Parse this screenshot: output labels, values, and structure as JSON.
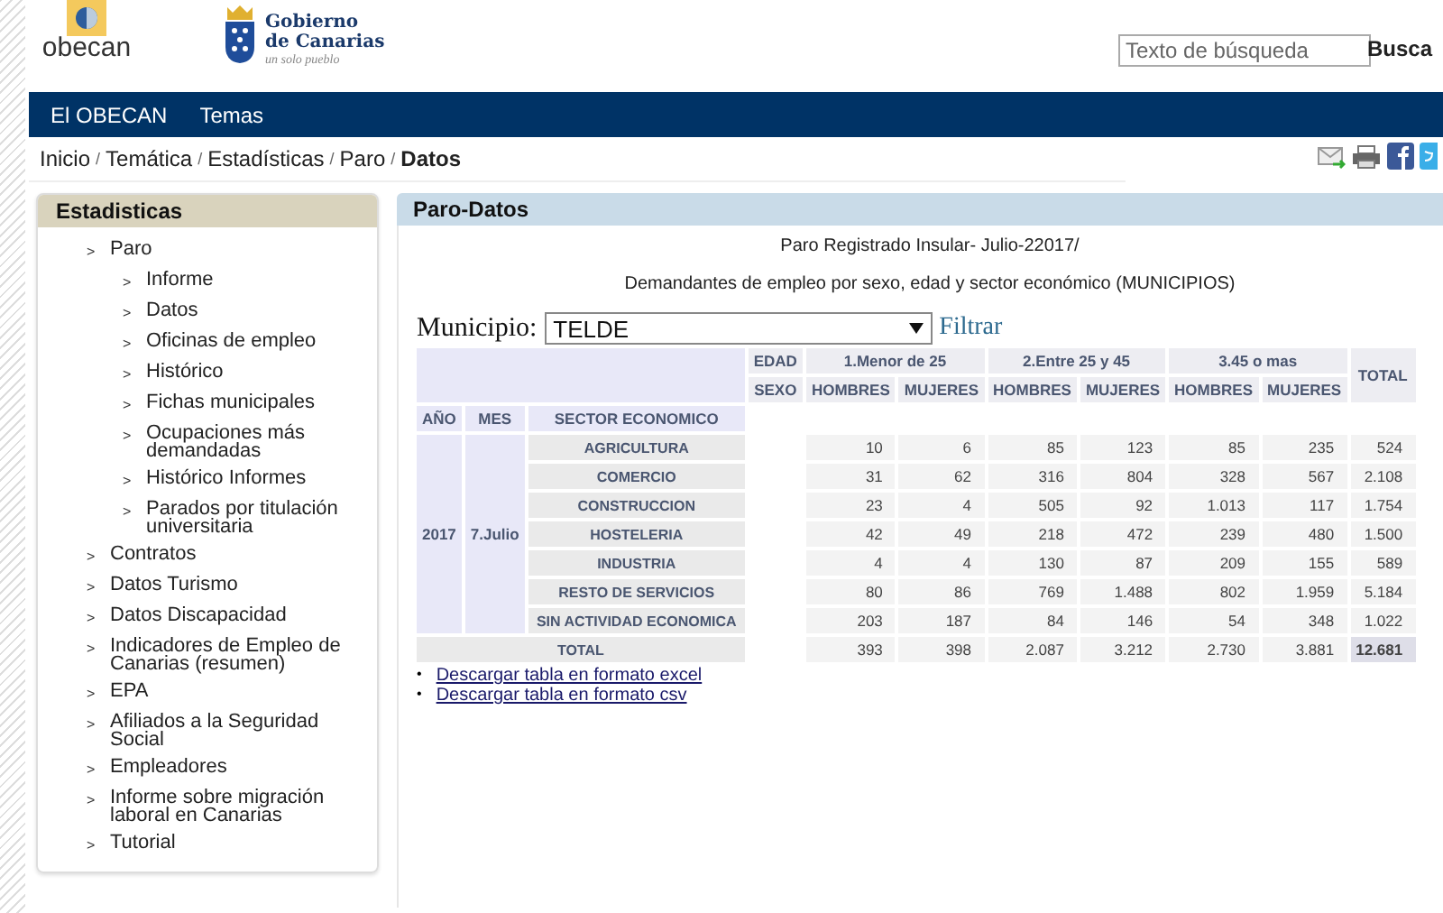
{
  "header": {
    "logo_text": "obecan",
    "gov_name_lines": [
      "Gobierno",
      "de Canarias"
    ],
    "gov_tagline": "un solo pueblo",
    "search": {
      "placeholder": "Texto de búsqueda"
    },
    "search_button": "Busca"
  },
  "nav": [
    "El OBECAN",
    "Temas"
  ],
  "breadcrumb": {
    "separator": "/",
    "items": [
      "Inicio",
      "Temática",
      "Estadísticas",
      "Paro",
      "Datos"
    ]
  },
  "sidebar": {
    "title": "Estadisticas",
    "bullet": ">",
    "items": [
      {
        "label": "Paro",
        "children": [
          {
            "label": "Informe"
          },
          {
            "label": "Datos"
          },
          {
            "label": "Oficinas de empleo"
          },
          {
            "label": "Histórico"
          },
          {
            "label": "Fichas municipales"
          },
          {
            "label": "Ocupaciones más demandadas"
          },
          {
            "label": "Histórico Informes"
          },
          {
            "label": "Parados por titulación universitaria"
          }
        ]
      },
      {
        "label": "Contratos"
      },
      {
        "label": "Datos Turismo"
      },
      {
        "label": "Datos Discapacidad"
      },
      {
        "label": "Indicadores de Empleo de Canarias (resumen)"
      },
      {
        "label": "EPA"
      },
      {
        "label": "Afiliados a la Seguridad Social"
      },
      {
        "label": "Empleadores"
      },
      {
        "label": "Informe sobre migración laboral en Canarias"
      },
      {
        "label": "Tutorial"
      }
    ]
  },
  "panel": {
    "title": "Paro-Datos",
    "report_title": "Paro Registrado Insular- Julio-22017/",
    "subtitle": "Demandantes de empleo por sexo, edad y sector económico (MUNICIPIOS)",
    "filter": {
      "label": "Municipio:",
      "value": "TELDE",
      "button": "Filtrar"
    },
    "table": {
      "edad_label": "EDAD",
      "sexo_label": "SEXO",
      "age_groups": [
        "1.Menor de 25",
        "2.Entre 25 y 45",
        "3.45 o mas"
      ],
      "sexes": [
        "HOMBRES",
        "MUJERES",
        "HOMBRES",
        "MUJERES",
        "HOMBRES",
        "MUJERES"
      ],
      "total_label": "TOTAL",
      "row_headers": [
        "AÑO",
        "MES",
        "SECTOR ECONOMICO"
      ],
      "year": "2017",
      "month": "7.Julio",
      "rows": [
        {
          "sector": "AGRICULTURA",
          "values": [
            "10",
            "6",
            "85",
            "123",
            "85",
            "235",
            "524"
          ]
        },
        {
          "sector": "COMERCIO",
          "values": [
            "31",
            "62",
            "316",
            "804",
            "328",
            "567",
            "2.108"
          ]
        },
        {
          "sector": "CONSTRUCCION",
          "values": [
            "23",
            "4",
            "505",
            "92",
            "1.013",
            "117",
            "1.754"
          ]
        },
        {
          "sector": "HOSTELERIA",
          "values": [
            "42",
            "49",
            "218",
            "472",
            "239",
            "480",
            "1.500"
          ]
        },
        {
          "sector": "INDUSTRIA",
          "values": [
            "4",
            "4",
            "130",
            "87",
            "209",
            "155",
            "589"
          ]
        },
        {
          "sector": "RESTO DE SERVICIOS",
          "values": [
            "80",
            "86",
            "769",
            "1.488",
            "802",
            "1.959",
            "5.184"
          ]
        },
        {
          "sector": "SIN ACTIVIDAD ECONOMICA",
          "values": [
            "203",
            "187",
            "84",
            "146",
            "54",
            "348",
            "1.022"
          ]
        }
      ],
      "total_row": {
        "label": "TOTAL",
        "values": [
          "393",
          "398",
          "2.087",
          "3.212",
          "2.730",
          "3.881",
          "12.681"
        ]
      }
    },
    "downloads": {
      "bullet": "•",
      "items": [
        "Descargar tabla en formato excel",
        "Descargar tabla en formato csv"
      ]
    }
  }
}
